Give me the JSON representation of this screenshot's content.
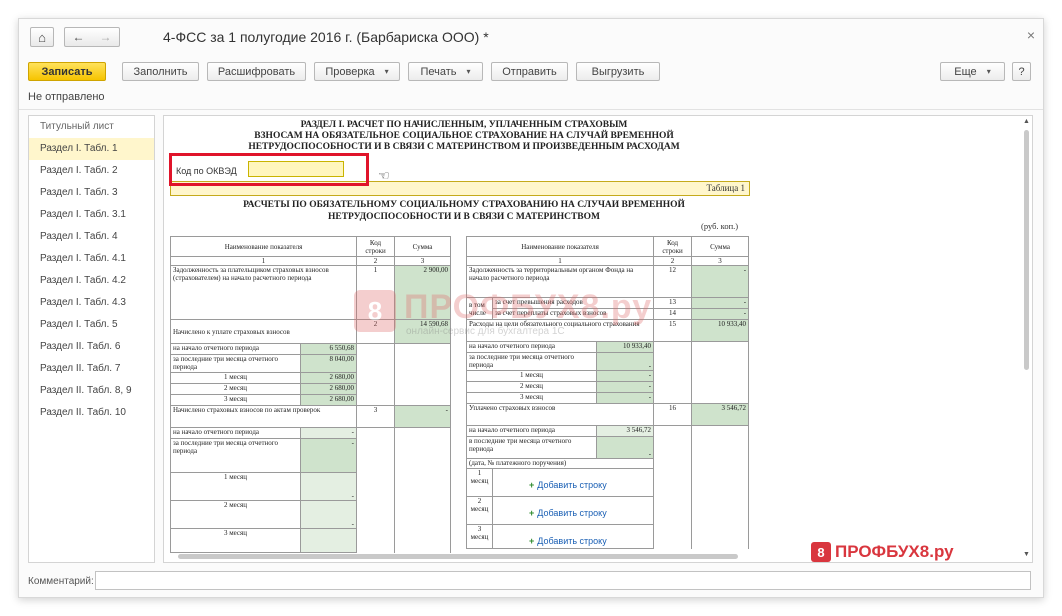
{
  "window": {
    "title": "4-ФСС за 1 полугодие 2016 г. (Барбариска ООО) *",
    "close_glyph": "×"
  },
  "toolbar": {
    "save": "Записать",
    "fill": "Заполнить",
    "decode": "Расшифровать",
    "check": "Проверка",
    "print": "Печать",
    "send": "Отправить",
    "export": "Выгрузить",
    "more": "Еще",
    "help": "?"
  },
  "status": "Не отправлено",
  "sidebar": {
    "items": [
      {
        "label": "Титульный лист"
      },
      {
        "label": "Раздел I. Табл. 1",
        "active": true
      },
      {
        "label": "Раздел I. Табл. 2"
      },
      {
        "label": "Раздел I. Табл. 3"
      },
      {
        "label": "Раздел I. Табл. 3.1"
      },
      {
        "label": "Раздел I. Табл. 4"
      },
      {
        "label": "Раздел I. Табл. 4.1"
      },
      {
        "label": "Раздел I. Табл. 4.2"
      },
      {
        "label": "Раздел I. Табл. 4.3"
      },
      {
        "label": "Раздел I. Табл. 5"
      },
      {
        "label": "Раздел II. Табл. 6"
      },
      {
        "label": "Раздел II. Табл. 7"
      },
      {
        "label": "Раздел II. Табл. 8, 9"
      },
      {
        "label": "Раздел II. Табл. 10"
      }
    ]
  },
  "form": {
    "section_title_1": "РАЗДЕЛ I.   РАСЧЕТ ПО НАЧИСЛЕННЫМ, УПЛАЧЕННЫМ СТРАХОВЫМ",
    "section_title_2": "ВЗНОСАМ НА ОБЯЗАТЕЛЬНОЕ СОЦИАЛЬНОЕ СТРАХОВАНИЕ НА СЛУЧАЙ ВРЕМЕННОЙ",
    "section_title_3": "НЕТРУДОСПОСОБНОСТИ И В СВЯЗИ С МАТЕРИНСТВОМ И ПРОИЗВЕДЕННЫМ РАСХОДАМ",
    "okved_label": "Код по ОКВЭД",
    "okved_value": "",
    "table_label": "Таблица 1",
    "table_title_1": "РАСЧЕТЫ ПО ОБЯЗАТЕЛЬНОМУ СОЦИАЛЬНОМУ СТРАХОВАНИЮ НА СЛУЧАИ ВРЕМЕННОЙ",
    "table_title_2": "НЕТРУДОСПОСОБНОСТИ И В СВЯЗИ С МАТЕРИНСТВОМ",
    "unit": "(руб. коп.)",
    "headers": {
      "name": "Наименование показателя",
      "code": "Код строки",
      "sum": "Сумма",
      "n1": "1",
      "n2": "2",
      "n3": "3"
    },
    "left": {
      "debt_start": "Задолженность за плательщиком страховых взносов (страхователем) на начало расчетного периода",
      "debt_start_code": "1",
      "debt_start_sum": "2 900,00",
      "accrued": "Начислено к уплате страховых взносов",
      "accrued_code": "2",
      "accrued_sum": "14 590,68",
      "start_period": "на начало отчетного периода",
      "start_period_val": "6 550,68",
      "last3": "за последние три месяца отчетного периода",
      "last3_val": "8 040,00",
      "m1": "1 месяц",
      "m1_val": "2 680,00",
      "m2": "2 месяц",
      "m2_val": "2 680,00",
      "m3": "3 месяц",
      "m3_val": "2 680,00",
      "acts": "Начислено страховых взносов по актам проверок",
      "acts_code": "3",
      "acts_sum": "-",
      "acts_start": "на начало отчетного периода",
      "acts_start_val": "-",
      "acts_last3": "за последние три месяца отчетного периода",
      "acts_last3_val": "-",
      "acts_m1": "1 месяц",
      "acts_m1_val": "-",
      "acts_m2": "2 месяц",
      "acts_m2_val": "-",
      "acts_m3": "3 месяц"
    },
    "right": {
      "debt_start": "Задолженность за территориальным органом Фонда на  начало расчетного периода",
      "debt_start_code": "12",
      "debt_start_sum": "-",
      "incl": "в том числе",
      "excess": "за счет превышения расходов",
      "excess_code": "13",
      "excess_sum": "-",
      "overpaid": "за счет переплаты страховых взносов",
      "overpaid_code": "14",
      "overpaid_sum": "-",
      "expenses": "Расходы на цели обязательного социального страхования",
      "expenses_code": "15",
      "expenses_sum": "10 933,40",
      "start_period": "на начало отчетного периода",
      "start_period_val": "10 933,40",
      "last3": "за последние три месяца отчетного периода",
      "last3_val": "-",
      "m1": "1 месяц",
      "m1_val": "-",
      "m2": "2 месяц",
      "m2_val": "-",
      "m3": "3 месяц",
      "m3_val": "-",
      "paid": "Уплачено страховых взносов",
      "paid_code": "16",
      "paid_sum": "3 546,72",
      "paid_start": "на начало отчетного периода",
      "paid_start_val": "3 546,72",
      "paid_last3": "в последние три месяца отчетного периода",
      "paid_last3_val": "-",
      "paid_date": "(дата, № платежного поручения)",
      "pm1": "1 месяц",
      "pm2": "2 месяц",
      "pm3": "3 месяц",
      "add_row": "Добавить строку",
      "add_row_2": "Добавить строку",
      "add_row_3": "Добавить строку"
    }
  },
  "watermark": {
    "brand": "ПРОФБУХ8.ру",
    "brand_small": "ПРОФБУХ8.ру",
    "tagline": "онлайн-сервис для бухгалтера 1С"
  },
  "comment": {
    "label": "Комментарий:",
    "value": ""
  },
  "icons": {
    "home": "⌂",
    "back": "←",
    "forward": "→",
    "caret": "▾",
    "hand": "☜",
    "scroll_up": "▲",
    "scroll_down": "▼"
  },
  "colors": {
    "primary": "#f6c400",
    "active_item": "#fff6cc",
    "highlight_frame": "#e0142a",
    "green_cell": "#cfe3cc"
  }
}
